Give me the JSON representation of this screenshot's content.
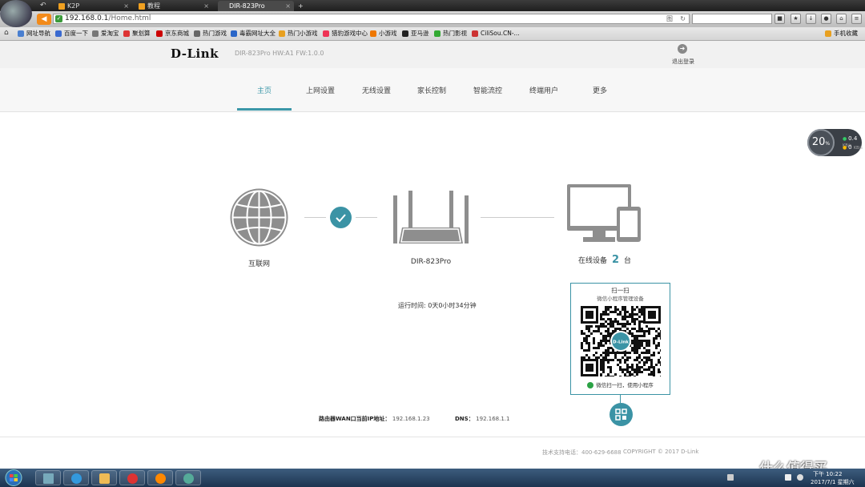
{
  "browser": {
    "tabs": [
      {
        "title": "K2P",
        "close": "×"
      },
      {
        "title": "教程",
        "close": "×"
      },
      {
        "title": "DIR-823Pro",
        "close": "×"
      }
    ],
    "new_tab": "+",
    "url_host": "192.168.0.1",
    "url_path": "/Home.html",
    "url_suffix": "图",
    "bookmarks": [
      "网址导航",
      "百度一下",
      "爱淘宝",
      "聚划算",
      "京东商城",
      "热门游戏",
      "毒霸网址大全",
      "热门小游戏",
      "猎豹游戏中心",
      "小游戏",
      "亚马逊",
      "热门影视",
      "CiliSou.CN-...",
      "手机收藏"
    ]
  },
  "router": {
    "brand": "D-Link",
    "model_info": "DIR-823Pro  HW:A1  FW:1.0.0",
    "logout_label": "退出登录",
    "nav": [
      {
        "label": "主页",
        "active": true
      },
      {
        "label": "上网设置"
      },
      {
        "label": "无线设置"
      },
      {
        "label": "家长控制"
      },
      {
        "label": "智能流控"
      },
      {
        "label": "终端用户"
      },
      {
        "label": "更多"
      }
    ],
    "speed": {
      "percent": "20",
      "percent_unit": "%",
      "up": "0.4",
      "down": "0",
      "unit": "KB/s"
    },
    "topology": {
      "internet_label": "互联网",
      "router_label": "DIR-823Pro",
      "devices_prefix": "在线设备",
      "devices_count": "2",
      "devices_suffix": "台"
    },
    "uptime": "运行时间: 0天0小时34分钟",
    "qr": {
      "title": "扫一扫",
      "subtitle": "微信小程序管理设备",
      "center_logo": "D-Link",
      "footer": "微信扫一扫，使用小程序"
    },
    "wan_label": "路由器WAN口当前IP地址：",
    "wan_ip": "192.168.1.23",
    "dns_label": "DNS：",
    "dns_ip": "192.168.1.1",
    "support": "技术支持电话：400-629-6688",
    "copyright": "COPYRIGHT © 2017 D-Link"
  },
  "taskbar": {
    "time": "下午 10:22",
    "date": "2017/7/1 星期六"
  },
  "watermark": "什么值得买",
  "colors": {
    "accent": "#3b97a8",
    "browser_orange": "#f28a1a"
  }
}
